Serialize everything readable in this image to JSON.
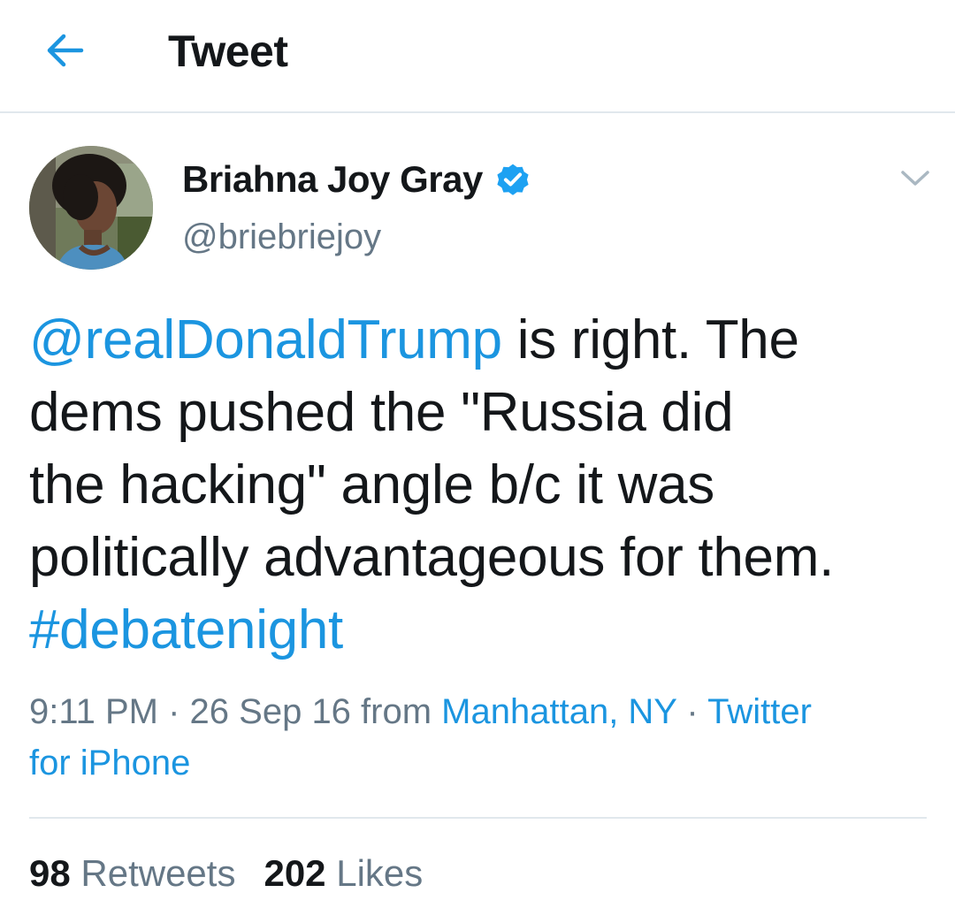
{
  "colors": {
    "accent": "#1b95e0",
    "text": "#14171a",
    "secondary": "#657786",
    "divider": "#e1e8ed"
  },
  "header": {
    "back_icon": "arrow-left-icon",
    "title": "Tweet"
  },
  "author": {
    "name": "Briahna Joy Gray",
    "handle": "@briebriejoy",
    "verified_icon": "verified-badge-icon",
    "menu_icon": "chevron-down-icon"
  },
  "tweet": {
    "lines": [
      {
        "mention": "@realDonaldTrump",
        "text": " is right. The"
      },
      {
        "text": "dems pushed the \"Russia did"
      },
      {
        "text": "the hacking\" angle b/c it was"
      },
      {
        "text": "politically advantageous for them."
      },
      {
        "hashtag": "#debatenight"
      }
    ]
  },
  "meta": {
    "time": "9:11 PM",
    "sep1": " · ",
    "date": "26 Sep 16",
    "from": " from ",
    "location": "Manhattan, NY",
    "sep2": " · ",
    "source_line1": "Twitter",
    "source_line2": "for iPhone"
  },
  "stats": {
    "retweets_count": "98",
    "retweets_label": " Retweets",
    "likes_count": "202",
    "likes_label": " Likes"
  }
}
